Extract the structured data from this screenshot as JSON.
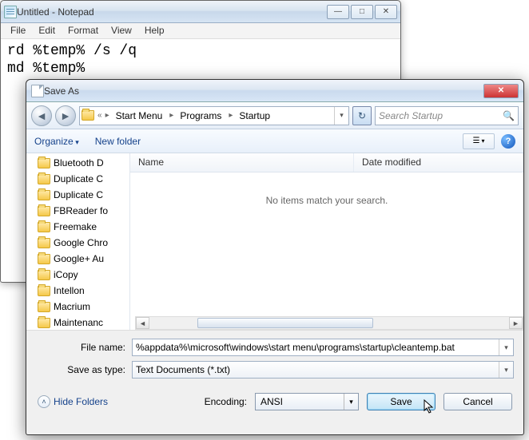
{
  "notepad": {
    "title": "Untitled - Notepad",
    "menus": [
      "File",
      "Edit",
      "Format",
      "View",
      "Help"
    ],
    "content": "rd %temp% /s /q\nmd %temp%"
  },
  "dialog": {
    "title": "Save As",
    "breadcrumbs": [
      "Start Menu",
      "Programs",
      "Startup"
    ],
    "search_placeholder": "Search Startup",
    "toolbar": {
      "organize": "Organize",
      "new_folder": "New folder"
    },
    "tree_items": [
      "Bluetooth D",
      "Duplicate C",
      "Duplicate C",
      "FBReader fo",
      "Freemake",
      "Google Chro",
      "Google+ Au",
      "iCopy",
      "Intellon",
      "Macrium",
      "Maintenanc"
    ],
    "columns": {
      "name": "Name",
      "date": "Date modified"
    },
    "empty_message": "No items match your search.",
    "file_name_label": "File name:",
    "file_name_value": "%appdata%\\microsoft\\windows\\start menu\\programs\\startup\\cleantemp.bat",
    "save_type_label": "Save as type:",
    "save_type_value": "Text Documents (*.txt)",
    "hide_folders": "Hide Folders",
    "encoding_label": "Encoding:",
    "encoding_value": "ANSI",
    "save_btn": "Save",
    "cancel_btn": "Cancel"
  }
}
